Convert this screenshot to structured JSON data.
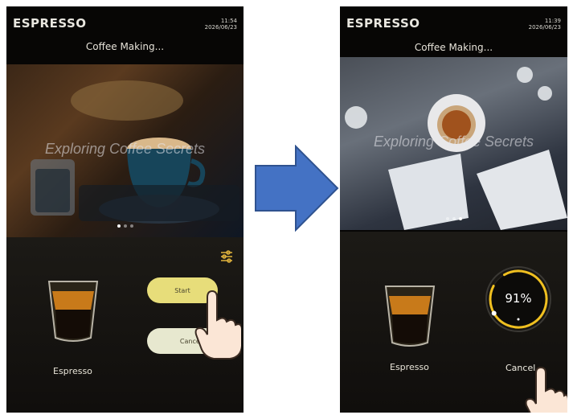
{
  "left": {
    "brand": "ESPRESSO",
    "time": "11:54",
    "date": "2026/06/23",
    "status": "Coffee Making...",
    "hero_caption": "Exploring Coffee Secrets",
    "drink_name": "Espresso",
    "start_label": "Start",
    "cancel_label": "Cancel"
  },
  "right": {
    "brand": "ESPRESSO",
    "time": "11:39",
    "date": "2026/06/23",
    "status": "Coffee Making...",
    "hero_caption": "Exploring Coffee Secrets",
    "drink_name": "Espresso",
    "progress_text": "91%",
    "progress_value": 0.91,
    "cancel_label": "Cancel"
  },
  "colors": {
    "brand_text": "#e8e6df",
    "start_button": "#e7dd7a",
    "cancel_button": "#e7e8cf",
    "progress_ring": "#f0c020",
    "arrow_fill": "#4472c4"
  },
  "icons": {
    "settings": "sliders-icon",
    "pointer": "hand-pointer-icon",
    "transition": "right-arrow-icon"
  }
}
